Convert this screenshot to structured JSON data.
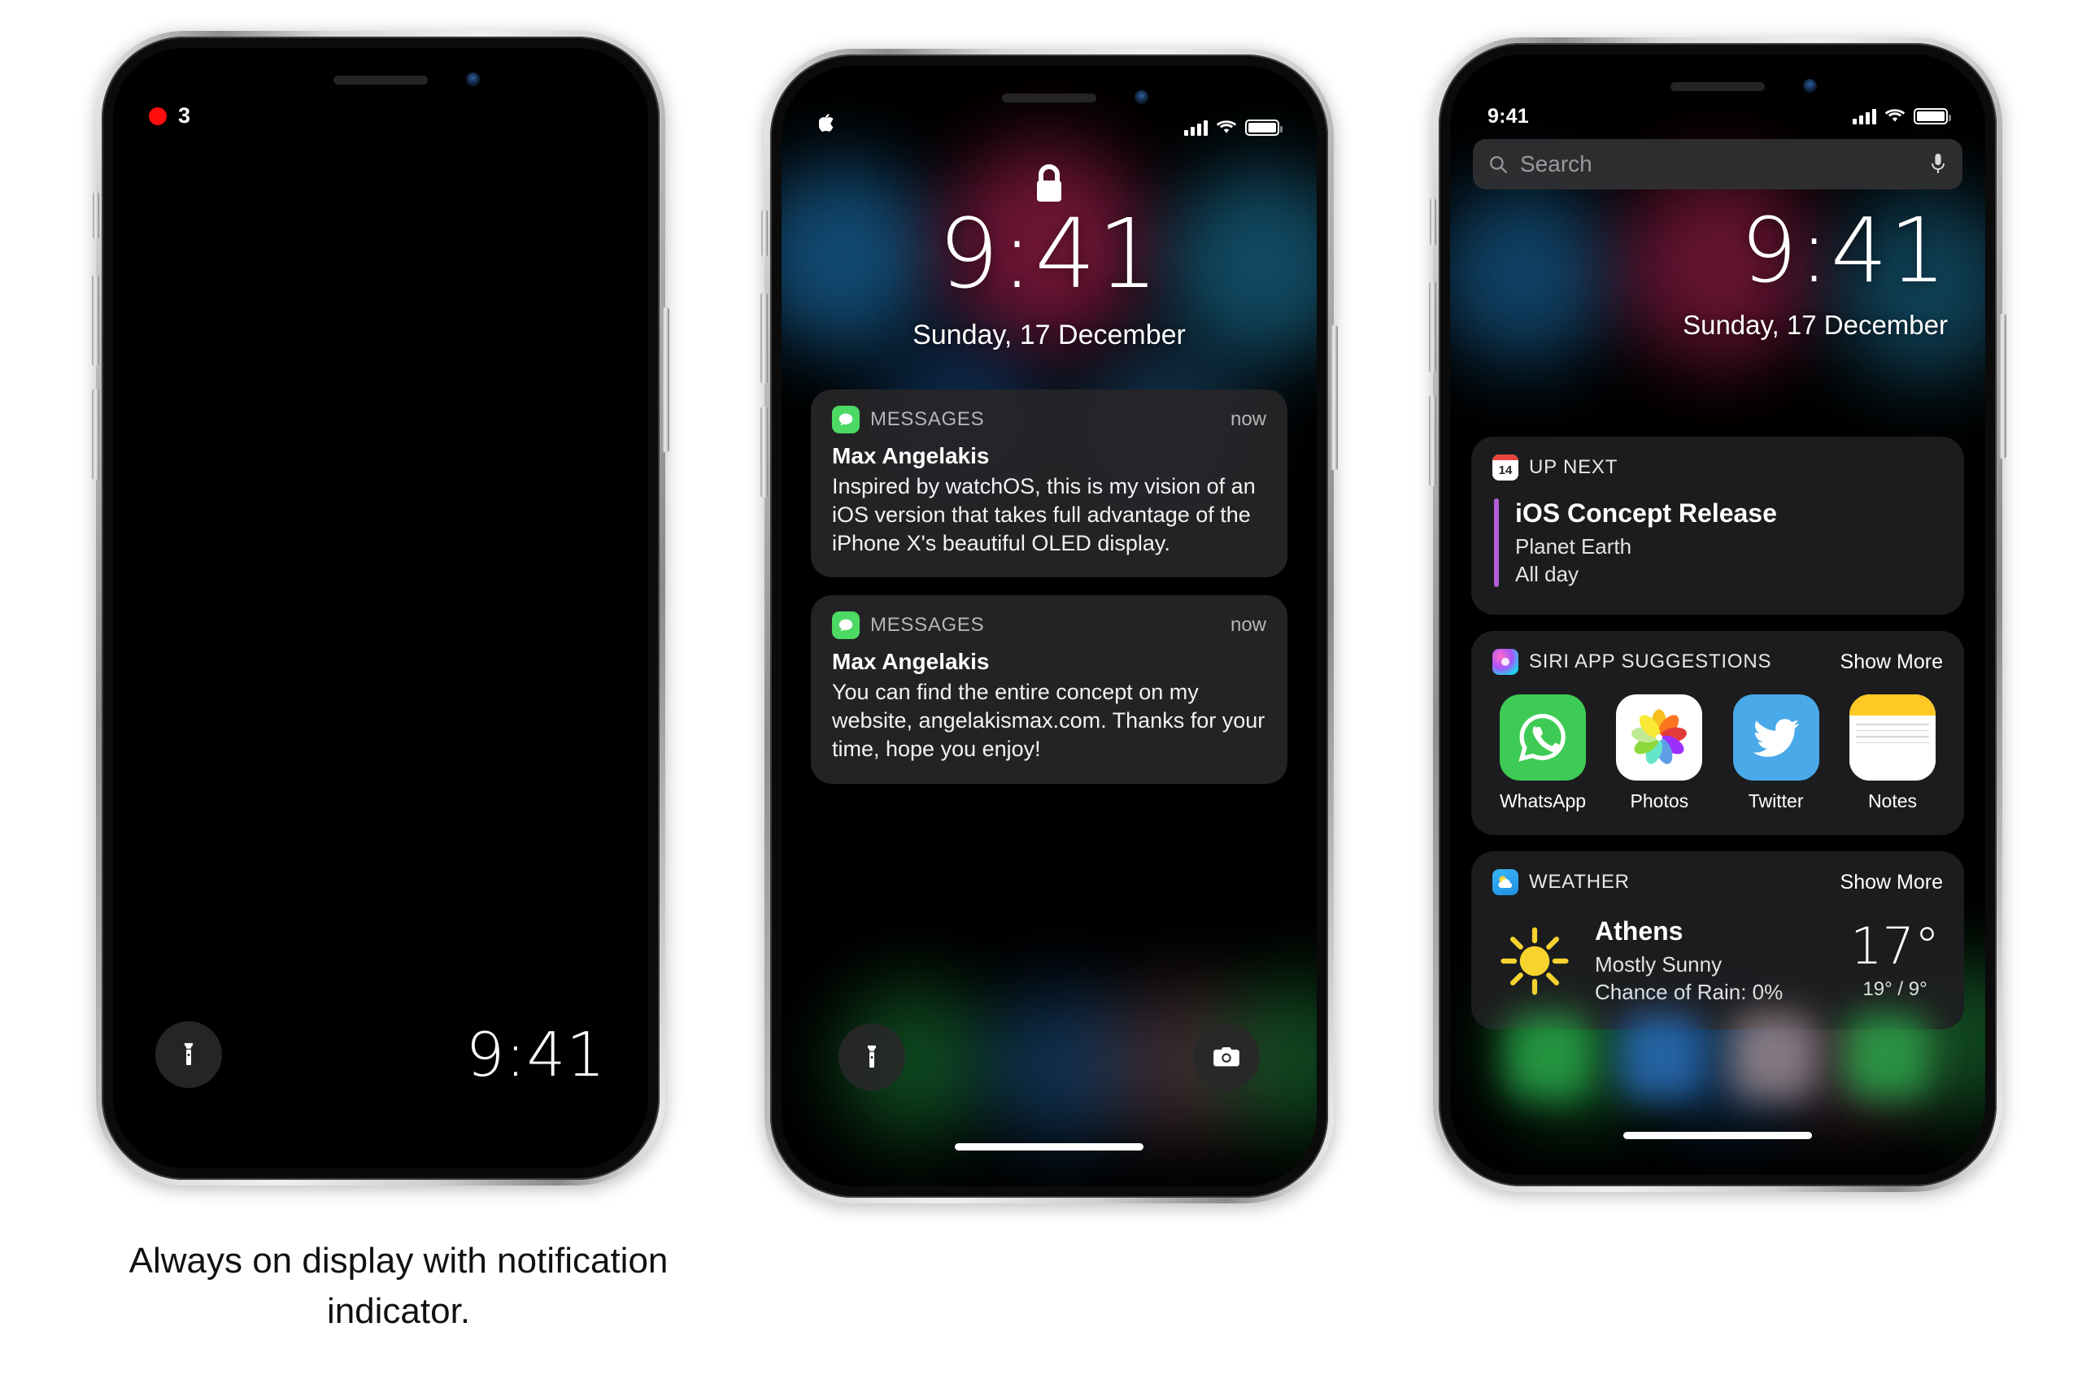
{
  "caption": {
    "text": "Always on display with notification indicator."
  },
  "colors": {
    "accent_red": "#ff0d0d",
    "messages_green": "#4cd964",
    "event_purple": "#b05fd8",
    "weather_blue": "#35aaf5",
    "sun_yellow": "#f7d32e",
    "twitter_blue": "#4aa9e8",
    "whatsapp_green": "#3ecb55",
    "notes_yellow": "#fec925"
  },
  "phone1": {
    "name": "always-on-display",
    "notification_indicator": {
      "count": "3",
      "dot_color": "#ff0d0d"
    },
    "flashlight_icon": "flashlight-icon",
    "time": "9:41"
  },
  "phone2": {
    "name": "lock-screen",
    "statusbar": {
      "left_icon": "apple-logo-icon",
      "signal_icon": "cellular-signal-icon",
      "wifi_icon": "wifi-icon",
      "battery_icon": "battery-icon"
    },
    "lock_icon": "lock-closed-icon",
    "time": "9:41",
    "date": "Sunday, 17 December",
    "notifications": [
      {
        "app": "MESSAGES",
        "app_icon": "messages-icon",
        "time": "now",
        "title": "Max Angelakis",
        "body": "Inspired by watchOS, this is my vision of an iOS version that takes full advantage of the iPhone X's beautiful OLED display."
      },
      {
        "app": "MESSAGES",
        "app_icon": "messages-icon",
        "time": "now",
        "title": "Max Angelakis",
        "body": "You can find the entire concept on my website, angelakismax.com. Thanks for your time, hope you enjoy!"
      }
    ],
    "shortcuts": [
      {
        "name": "flashlight-button",
        "icon": "flashlight-icon"
      },
      {
        "name": "camera-button",
        "icon": "camera-icon"
      }
    ],
    "home_indicator": "home-indicator"
  },
  "phone3": {
    "name": "today-view",
    "statusbar": {
      "time": "9:41"
    },
    "search": {
      "placeholder": "Search",
      "search_icon": "search-icon",
      "mic_icon": "microphone-icon"
    },
    "time": "9:41",
    "date": "Sunday, 17 December",
    "widgets": {
      "up_next": {
        "title": "UP NEXT",
        "icon": "calendar-icon",
        "calendar_day": "14",
        "event_title": "iOS Concept Release",
        "event_location": "Planet Earth",
        "event_time": "All day"
      },
      "siri_suggestions": {
        "title": "SIRI APP SUGGESTIONS",
        "icon": "siri-icon",
        "show_more": "Show More",
        "apps": [
          {
            "label": "WhatsApp",
            "icon": "whatsapp-icon"
          },
          {
            "label": "Photos",
            "icon": "photos-icon"
          },
          {
            "label": "Twitter",
            "icon": "twitter-icon"
          },
          {
            "label": "Notes",
            "icon": "notes-icon"
          }
        ]
      },
      "weather": {
        "title": "WEATHER",
        "icon": "weather-icon",
        "show_more": "Show More",
        "condition_icon": "sun-icon",
        "city": "Athens",
        "condition": "Mostly Sunny",
        "rain": "Chance of Rain: 0%",
        "temperature": "17°",
        "high_low": "19° / 9°"
      }
    },
    "home_indicator": "home-indicator"
  }
}
